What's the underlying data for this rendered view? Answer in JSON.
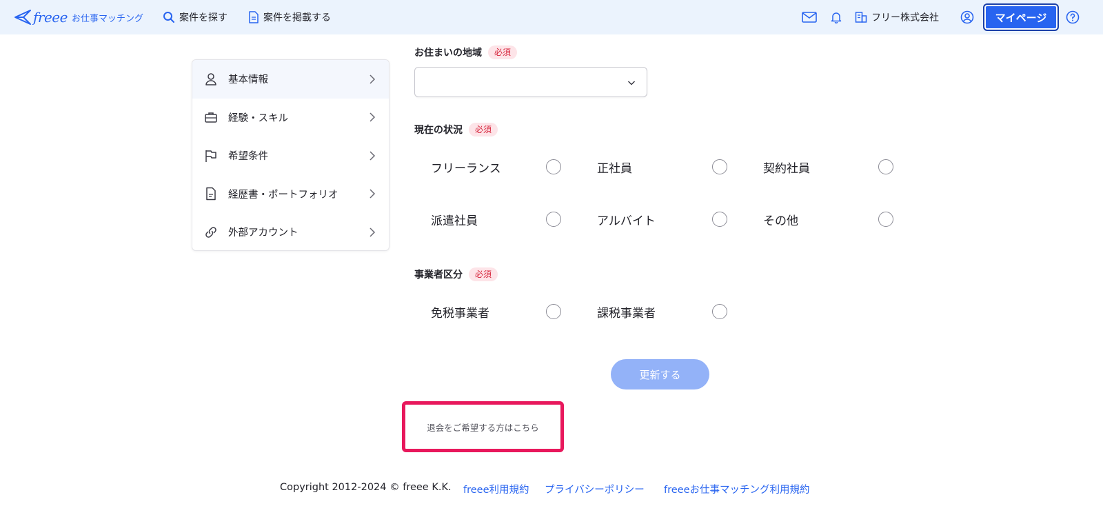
{
  "header": {
    "logo_brand": "freee",
    "logo_sub": "お仕事マッチング",
    "nav": [
      {
        "label": "案件を探す",
        "icon": "search-icon"
      },
      {
        "label": "案件を掲載する",
        "icon": "document-icon"
      }
    ],
    "icons": [
      "mail-icon",
      "bell-icon",
      "company-icon",
      "user-circle-icon",
      "help-icon"
    ],
    "company_name": "フリー株式会社",
    "mypage_label": "マイページ"
  },
  "sidebar": {
    "items": [
      {
        "label": "基本情報",
        "icon": "person-icon",
        "active": true
      },
      {
        "label": "経験・スキル",
        "icon": "briefcase-icon",
        "active": false
      },
      {
        "label": "希望条件",
        "icon": "flag-icon",
        "active": false
      },
      {
        "label": "経歴書・ポートフォリオ",
        "icon": "file-icon",
        "active": false
      },
      {
        "label": "外部アカウント",
        "icon": "link-icon",
        "active": false
      }
    ]
  },
  "form": {
    "region": {
      "label": "お住まいの地域",
      "required_badge": "必須",
      "value": ""
    },
    "status": {
      "label": "現在の状況",
      "required_badge": "必須",
      "options": [
        "フリーランス",
        "正社員",
        "契約社員",
        "派遣社員",
        "アルバイト",
        "その他"
      ]
    },
    "business": {
      "label": "事業者区分",
      "required_badge": "必須",
      "options": [
        "免税事業者",
        "課税事業者"
      ]
    },
    "submit_label": "更新する",
    "withdraw_label": "退会をご希望する方はこちら"
  },
  "footer": {
    "copyright": "Copyright 2012-2024 © freee K.K.",
    "links": [
      "freee利用規約",
      "プライバシーポリシー",
      "freeeお仕事マッチング利用規約"
    ]
  },
  "colors": {
    "brand": "#2864f0",
    "header_bg": "#ebf3fd",
    "required_bg": "#fde4e8",
    "required_text": "#d7263d",
    "highlight_border": "#e8185c",
    "disabled_button": "#93b2f8"
  }
}
